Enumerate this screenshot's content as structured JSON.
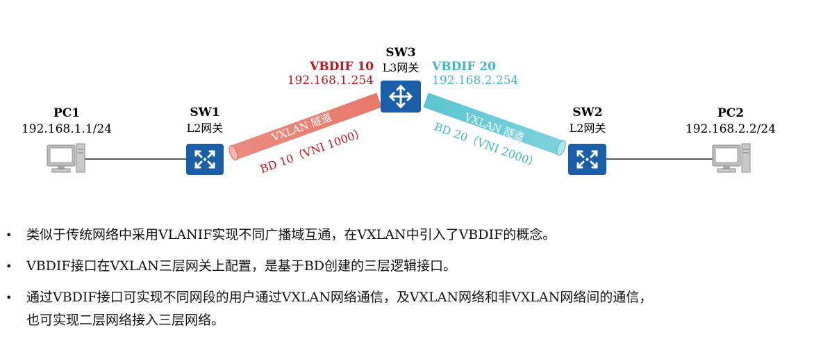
{
  "nodes": {
    "pc1": {
      "name": "PC1",
      "ip": "192.168.1.1/24"
    },
    "pc2": {
      "name": "PC2",
      "ip": "192.168.2.2/24"
    },
    "sw1": {
      "name": "SW1",
      "role": "L2网关"
    },
    "sw2": {
      "name": "SW2",
      "role": "L2网关"
    },
    "sw3": {
      "name": "SW3",
      "role": "L3网关"
    }
  },
  "interfaces": {
    "vbdif10": {
      "name": "VBDIF 10",
      "ip": "192.168.1.254",
      "color": "#c0161d"
    },
    "vbdif20": {
      "name": "VBDIF 20",
      "ip": "192.168.2.254",
      "color": "#3fb7c8"
    }
  },
  "tunnels": {
    "left": {
      "label": "VXLAN 隧道",
      "bd": "BD 10（VNI 1000）",
      "color": "#e8796b"
    },
    "right": {
      "label": "VXLAN 隧道",
      "bd": "BD 20（VNI 2000）",
      "color": "#5cc5d2"
    }
  },
  "icons": {
    "pc": "computer-icon",
    "l2switch": "switch-icon",
    "l3switch": "router-icon"
  },
  "colors": {
    "device_blue": "#1a5ea8"
  },
  "bullets": [
    {
      "text": "类似于传统网络中采用VLANIF实现不同广播域互通，在VXLAN中引入了VBDIF的概念。"
    },
    {
      "text": "VBDIF接口在VXLAN三层网关上配置，是基于BD创建的三层逻辑接口。"
    },
    {
      "text": "通过VBDIF接口可实现不同网段的用户通过VXLAN网络通信，及VXLAN网络和非VXLAN网络间的通信，",
      "cont": "也可实现二层网络接入三层网络。"
    }
  ]
}
